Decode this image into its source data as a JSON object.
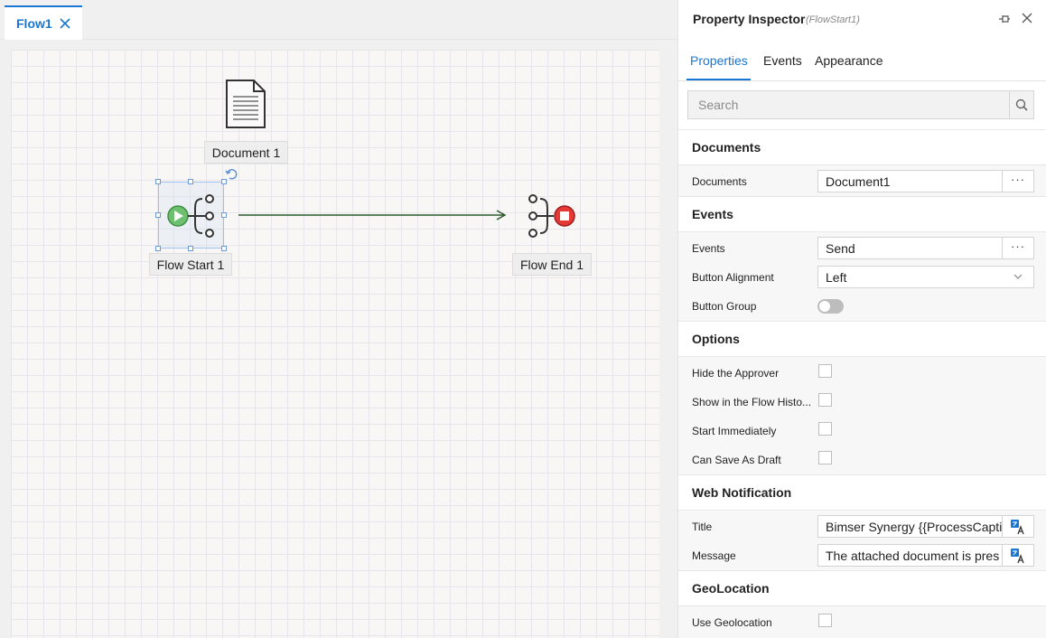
{
  "tabs": [
    {
      "label": "Flow1"
    }
  ],
  "canvas": {
    "nodes": {
      "document": {
        "label": "Document 1"
      },
      "flow_start": {
        "label": "Flow Start 1"
      },
      "flow_end": {
        "label": "Flow End 1"
      }
    }
  },
  "inspector": {
    "title": "Property Inspector",
    "subtitle": "(FlowStart1)",
    "tabs": [
      {
        "label": "Properties"
      },
      {
        "label": "Events"
      },
      {
        "label": "Appearance"
      }
    ],
    "search": {
      "placeholder": "Search"
    },
    "sections": {
      "documents": {
        "title": "Documents",
        "documents": {
          "label": "Documents",
          "value": "Document1"
        }
      },
      "events": {
        "title": "Events",
        "events": {
          "label": "Events",
          "value": "Send"
        },
        "button_alignment": {
          "label": "Button Alignment",
          "value": "Left"
        },
        "button_group": {
          "label": "Button Group",
          "checked": false
        }
      },
      "options": {
        "title": "Options",
        "items": [
          {
            "label": "Hide the Approver",
            "checked": false
          },
          {
            "label": "Show in the Flow Histo...",
            "checked": false
          },
          {
            "label": "Start Immediately",
            "checked": false
          },
          {
            "label": "Can Save As Draft",
            "checked": false
          }
        ]
      },
      "web_notification": {
        "title": "Web Notification",
        "title_field": {
          "label": "Title",
          "value": "Bimser Synergy {{ProcessCaptio"
        },
        "message_field": {
          "label": "Message",
          "value": "The attached document is pres"
        }
      },
      "geolocation": {
        "title": "GeoLocation",
        "use_geolocation": {
          "label": "Use Geolocation",
          "checked": false
        }
      }
    }
  },
  "colors": {
    "accent": "#1976d2",
    "start_green": "#5cb85c",
    "end_red": "#e53935",
    "connector": "#2e5a2e"
  }
}
